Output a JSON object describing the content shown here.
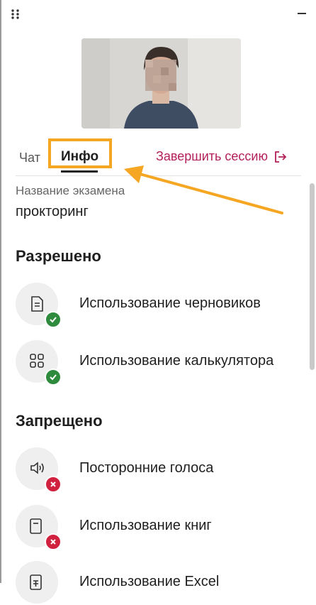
{
  "tabs": {
    "chat": "Чат",
    "info": "Инфо",
    "end_session": "Завершить сессию"
  },
  "exam": {
    "label": "Название экзамена",
    "value": "прокторинг"
  },
  "allowed": {
    "title": "Разрешено",
    "items": [
      {
        "label": "Использование черновиков",
        "icon": "document-icon"
      },
      {
        "label": "Использование калькулятора",
        "icon": "calculator-icon"
      }
    ]
  },
  "forbidden": {
    "title": "Запрещено",
    "items": [
      {
        "label": "Посторонние голоса",
        "icon": "speaker-icon"
      },
      {
        "label": "Использование книг",
        "icon": "book-icon"
      },
      {
        "label": "Использование Excel",
        "icon": "spreadsheet-icon"
      }
    ]
  },
  "colors": {
    "accent": "#b3205a",
    "highlight": "#f5a623",
    "allowed": "#2e8b3e",
    "forbidden": "#d0213f"
  }
}
